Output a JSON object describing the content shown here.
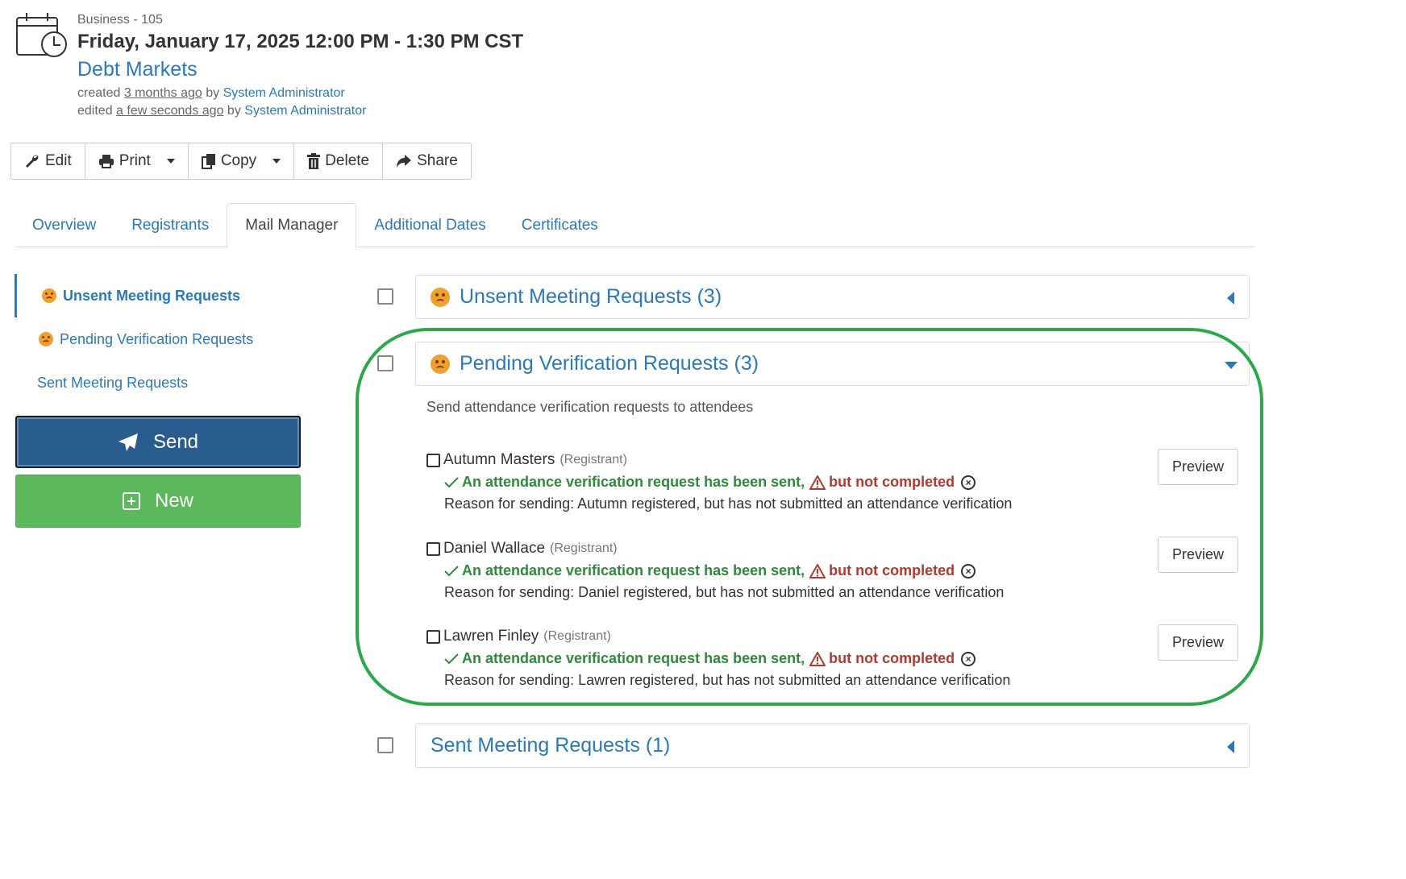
{
  "header": {
    "category": "Business - 105",
    "datetime": "Friday, January 17, 2025 12:00 PM - 1:30 PM CST",
    "title": "Debt Markets",
    "created_prefix": "created",
    "created_time": "3 months ago",
    "created_by_label": "by",
    "created_by": "System Administrator",
    "edited_prefix": "edited",
    "edited_time": "a few seconds ago",
    "edited_by_label": "by",
    "edited_by": "System Administrator"
  },
  "toolbar": {
    "edit": "Edit",
    "print": "Print",
    "copy": "Copy",
    "delete": "Delete",
    "share": "Share"
  },
  "tabs": [
    {
      "label": "Overview"
    },
    {
      "label": "Registrants"
    },
    {
      "label": "Mail Manager"
    },
    {
      "label": "Additional Dates"
    },
    {
      "label": "Certificates"
    }
  ],
  "active_tab": "Mail Manager",
  "sidenav": [
    {
      "label": "Unsent Meeting Requests",
      "icon": "frown-icon"
    },
    {
      "label": "Pending Verification Requests",
      "icon": "frown-icon"
    },
    {
      "label": "Sent Meeting Requests"
    }
  ],
  "buttons": {
    "send": "Send",
    "new": "New"
  },
  "panels": {
    "unsent": {
      "title": "Unsent Meeting Requests (3)"
    },
    "pending": {
      "title": "Pending Verification Requests (3)",
      "description": "Send attendance verification requests to attendees"
    },
    "sent": {
      "title": "Sent Meeting Requests (1)"
    }
  },
  "registrants": [
    {
      "name": "Autumn Masters",
      "role": "(Registrant)",
      "status_ok": "An attendance verification request has been sent,",
      "status_warn": "but not completed",
      "reason": "Reason for sending: Autumn registered, but has not submitted an attendance verification",
      "preview": "Preview"
    },
    {
      "name": "Daniel Wallace",
      "role": "(Registrant)",
      "status_ok": "An attendance verification request has been sent,",
      "status_warn": "but not completed",
      "reason": "Reason for sending: Daniel registered, but has not submitted an attendance verification",
      "preview": "Preview"
    },
    {
      "name": "Lawren Finley",
      "role": "(Registrant)",
      "status_ok": "An attendance verification request has been sent,",
      "status_warn": "but not completed",
      "reason": "Reason for sending: Lawren registered, but has not submitted an attendance verification",
      "preview": "Preview"
    }
  ],
  "colors": {
    "link": "#2a79b8",
    "send": "#2a5d8f",
    "new": "#5cb85c",
    "ok": "#2e8a3a",
    "warn": "#b03a2e",
    "highlight": "#2aa84a"
  }
}
